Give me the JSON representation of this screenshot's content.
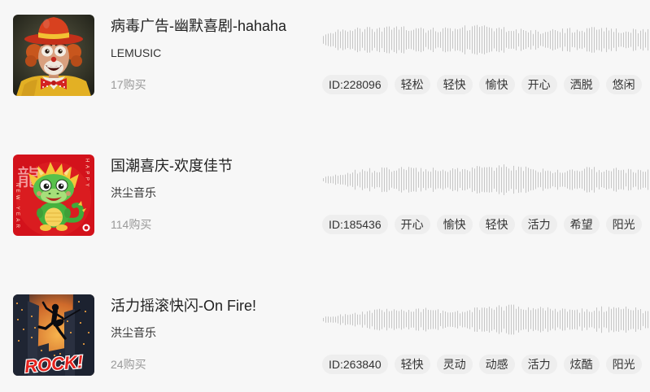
{
  "colors": {
    "page_bg": "#f7f7f7",
    "tag_bg": "#eeeeee",
    "title": "#222222",
    "text": "#333333",
    "muted": "#999999",
    "waveform": "#c6c6c6"
  },
  "tracks": [
    {
      "title": "病毒广告-幽默喜剧-hahaha",
      "artist": "LEMUSIC",
      "purchases": "17购买",
      "id_label": "ID:228096",
      "tags": [
        "轻松",
        "轻快",
        "愉快",
        "开心",
        "洒脱",
        "悠闲"
      ]
    },
    {
      "title": "国潮喜庆-欢度佳节",
      "artist": "洪尘音乐",
      "purchases": "114购买",
      "id_label": "ID:185436",
      "tags": [
        "开心",
        "愉快",
        "轻快",
        "活力",
        "希望",
        "阳光"
      ],
      "cover_text": [
        "龍",
        "HAPPY",
        "NEW YEAR"
      ]
    },
    {
      "title": "活力摇滚快闪-On Fire!",
      "artist": "洪尘音乐",
      "purchases": "24购买",
      "id_label": "ID:263840",
      "tags": [
        "轻快",
        "灵动",
        "动感",
        "活力",
        "炫酷",
        "阳光"
      ],
      "cover_text": [
        "ROCK!"
      ]
    }
  ]
}
